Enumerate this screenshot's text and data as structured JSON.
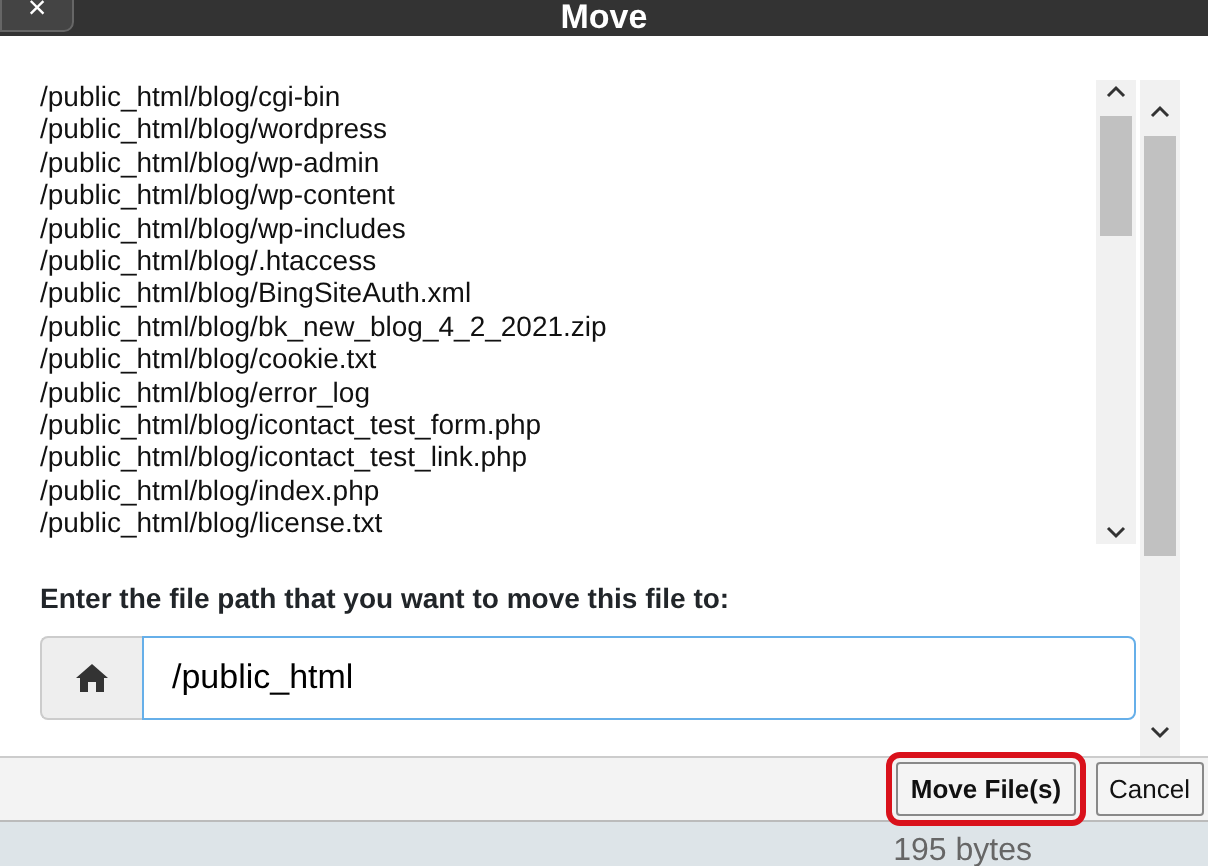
{
  "window": {
    "title": "Move",
    "close_label": "×"
  },
  "paths": [
    "/public_html/blog/cgi-bin",
    "/public_html/blog/wordpress",
    "/public_html/blog/wp-admin",
    "/public_html/blog/wp-content",
    "/public_html/blog/wp-includes",
    "/public_html/blog/.htaccess",
    "/public_html/blog/BingSiteAuth.xml",
    "/public_html/blog/bk_new_blog_4_2_2021.zip",
    "/public_html/blog/cookie.txt",
    "/public_html/blog/error_log",
    "/public_html/blog/icontact_test_form.php",
    "/public_html/blog/icontact_test_link.php",
    "/public_html/blog/index.php",
    "/public_html/blog/license.txt"
  ],
  "destination": {
    "label": "Enter the file path that you want to move this file to:",
    "value": "/public_html"
  },
  "buttons": [
    {
      "label": "Move File(s)",
      "highlighted": true
    },
    {
      "label": "Cancel",
      "highlighted": false
    }
  ],
  "status": "195 bytes"
}
